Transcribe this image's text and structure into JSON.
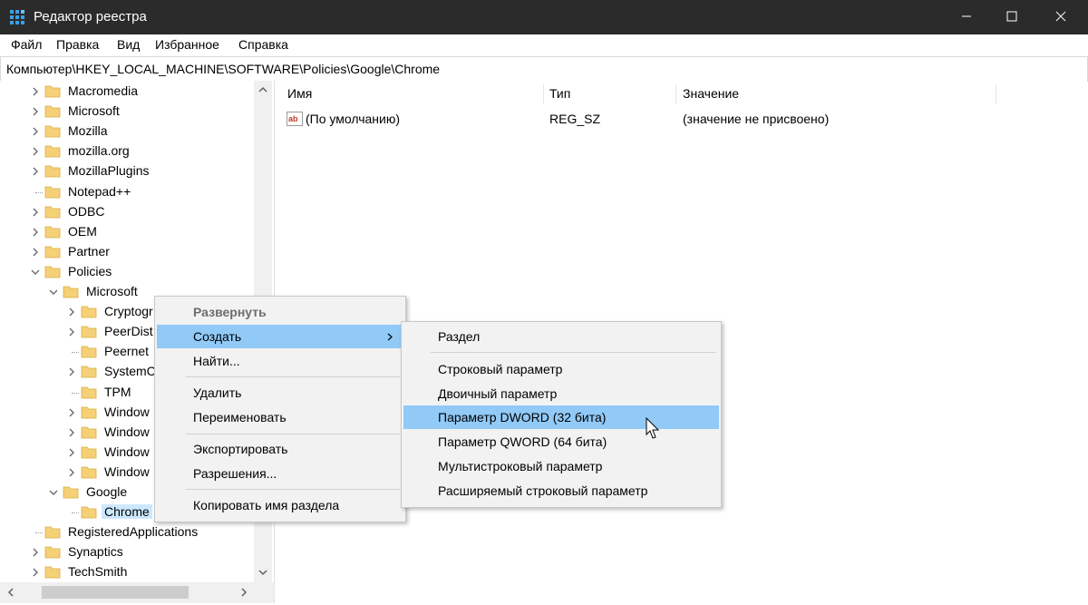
{
  "window": {
    "title": "Редактор реестра",
    "minimize_icon": "minimize-icon",
    "maximize_icon": "maximize-icon",
    "close_icon": "close-icon"
  },
  "menu": [
    "Файл",
    "Правка",
    "Вид",
    "Избранное",
    "Справка"
  ],
  "address": "Компьютер\\HKEY_LOCAL_MACHINE\\SOFTWARE\\Policies\\Google\\Chrome",
  "tree": [
    {
      "label": "Macromedia",
      "expander": "collapsed"
    },
    {
      "label": "Microsoft",
      "expander": "collapsed"
    },
    {
      "label": "Mozilla",
      "expander": "collapsed"
    },
    {
      "label": "mozilla.org",
      "expander": "collapsed"
    },
    {
      "label": "MozillaPlugins",
      "expander": "collapsed"
    },
    {
      "label": "Notepad++",
      "expander": "none"
    },
    {
      "label": "ODBC",
      "expander": "collapsed"
    },
    {
      "label": "OEM",
      "expander": "collapsed"
    },
    {
      "label": "Partner",
      "expander": "collapsed"
    },
    {
      "label": "Policies",
      "expander": "expanded"
    },
    {
      "label": "Microsoft",
      "expander": "expanded"
    },
    {
      "label": "Cryptogr",
      "expander": "collapsed"
    },
    {
      "label": "PeerDist",
      "expander": "collapsed"
    },
    {
      "label": "Peernet",
      "expander": "none"
    },
    {
      "label": "SystemC",
      "expander": "collapsed"
    },
    {
      "label": "TPM",
      "expander": "none"
    },
    {
      "label": "Window",
      "expander": "collapsed"
    },
    {
      "label": "Window",
      "expander": "collapsed"
    },
    {
      "label": "Window",
      "expander": "collapsed"
    },
    {
      "label": "Window",
      "expander": "collapsed"
    },
    {
      "label": "Google",
      "expander": "expanded"
    },
    {
      "label": "Chrome",
      "expander": "none",
      "selected": true
    },
    {
      "label": "RegisteredApplications",
      "expander": "none"
    },
    {
      "label": "Synaptics",
      "expander": "collapsed"
    },
    {
      "label": "TechSmith",
      "expander": "collapsed"
    }
  ],
  "columns": {
    "name": "Имя",
    "type": "Тип",
    "value": "Значение"
  },
  "values": [
    {
      "name": "(По умолчанию)",
      "type": "REG_SZ",
      "data": "(значение не присвоено)",
      "icon": "string-value-icon"
    }
  ],
  "context_menu": [
    {
      "label": "Развернуть",
      "state": "disabled-bold"
    },
    {
      "label": "Создать",
      "state": "highlighted",
      "submenu": true
    },
    {
      "label": "Найти...",
      "state": "normal"
    },
    {
      "label": "Удалить",
      "state": "normal"
    },
    {
      "label": "Переименовать",
      "state": "normal"
    },
    {
      "label": "Экспортировать",
      "state": "normal"
    },
    {
      "label": "Разрешения...",
      "state": "normal"
    },
    {
      "label": "Копировать имя раздела",
      "state": "normal"
    }
  ],
  "submenu": [
    {
      "label": "Раздел",
      "state": "normal"
    },
    {
      "label": "Строковый параметр",
      "state": "normal"
    },
    {
      "label": "Двоичный параметр",
      "state": "normal"
    },
    {
      "label": "Параметр DWORD (32 бита)",
      "state": "highlighted"
    },
    {
      "label": "Параметр QWORD (64 бита)",
      "state": "normal"
    },
    {
      "label": "Мультистроковый параметр",
      "state": "normal"
    },
    {
      "label": "Расширяемый строковый параметр",
      "state": "normal"
    }
  ],
  "colors": {
    "titlebar": "#2b2b2b",
    "menu_highlight": "#91c9f7",
    "menu_bg": "#f2f2f2",
    "folder": "#f5d076"
  }
}
